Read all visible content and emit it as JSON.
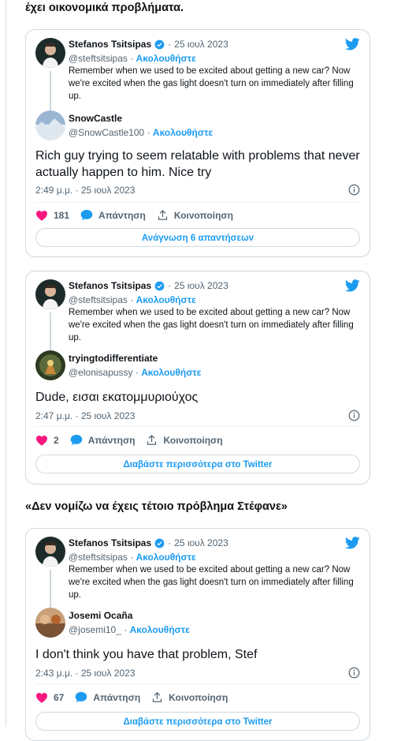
{
  "headings": {
    "top": "έχει οικονομικά προβλήματα.",
    "middle": "«Δεν νομίζω να έχεις τέτοιο πρόβλημα Στέφανε»"
  },
  "quoted": {
    "name": "Stefanos Tsitsipas",
    "separator": "·",
    "date": "25 ιουλ 2023",
    "handle": "@steftsitsipas",
    "follow": "Ακολουθήστε",
    "text": "Remember when we used to be excited about getting a new car? Now we're excited when the gas light doesn't turn on immediately after filling up."
  },
  "colors": {
    "accent": "#1d9bf0",
    "like": "#f91880",
    "text": "#0f1419",
    "muted": "#536471",
    "border": "#cfd9de"
  },
  "icons": {
    "bird": "twitter-bird-icon",
    "verified": "verified-badge-icon",
    "heart": "heart-icon",
    "reply": "reply-bubble-icon",
    "share": "share-icon",
    "info": "info-icon"
  },
  "cards": [
    {
      "reply_name": "SnowCastle",
      "reply_handle": "@SnowCastle100",
      "reply_text": "Rich guy trying to seem relatable with problems that never actually happen to him. Nice try",
      "time": "2:49 μ.μ. · 25 ιουλ 2023",
      "likes": "181",
      "reply_label": "Απάντηση",
      "share_label": "Κοινοποίηση",
      "button": "Ανάγνωση 6 απαντήσεων"
    },
    {
      "reply_name": "tryingtodifferentiate",
      "reply_handle": "@elonisapussy",
      "reply_text": "Dude, εισαι εκατομμυριούχος",
      "time": "2:47 μ.μ. · 25 ιουλ 2023",
      "likes": "2",
      "reply_label": "Απάντηση",
      "share_label": "Κοινοποίηση",
      "button": "Διαβάστε περισσότερα στο Twitter"
    },
    {
      "reply_name": "Josemi Ocaña",
      "reply_handle": "@josemi10_",
      "reply_text": "I don't think you have that problem, Stef",
      "time": "2:43 μ.μ. · 25 ιουλ 2023",
      "likes": "67",
      "reply_label": "Απάντηση",
      "share_label": "Κοινοποίηση",
      "button": "Διαβάστε περισσότερα στο Twitter"
    }
  ]
}
